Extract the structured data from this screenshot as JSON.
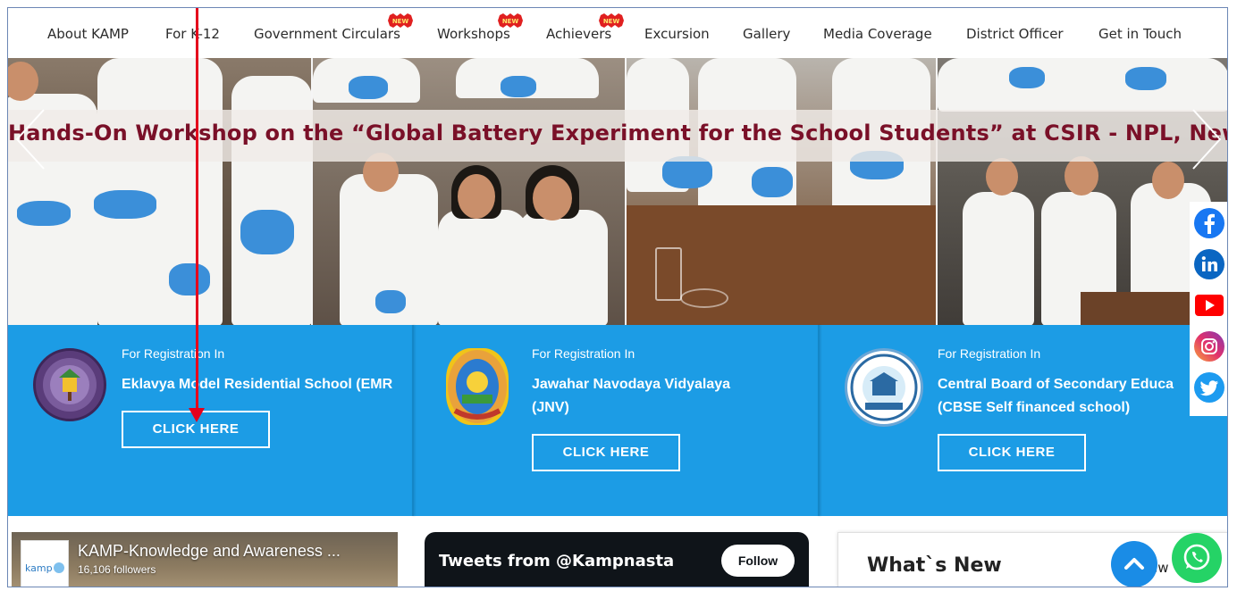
{
  "nav": {
    "items": [
      {
        "label": "About KAMP",
        "new": false
      },
      {
        "label": "For K-12",
        "new": false
      },
      {
        "label": "Government Circulars",
        "new": true
      },
      {
        "label": "Workshops",
        "new": true
      },
      {
        "label": "Achievers",
        "new": true
      },
      {
        "label": "Excursion",
        "new": false
      },
      {
        "label": "Gallery",
        "new": false
      },
      {
        "label": "Media Coverage",
        "new": false
      },
      {
        "label": "District Officer",
        "new": false
      },
      {
        "label": "Get in Touch",
        "new": false
      }
    ],
    "new_badge": "NEW"
  },
  "hero": {
    "banner": "Hands-On Workshop on the “Global Battery Experiment for the School Students” at CSIR - NPL, New Delhi"
  },
  "registration": {
    "prefix": "For Registration In",
    "button": "CLICK HERE",
    "cards": [
      {
        "name_line1": "Eklavya Model Residential School (EMR",
        "name_line2": ""
      },
      {
        "name_line1": "Jawahar Navodaya Vidyalaya",
        "name_line2": "(JNV)"
      },
      {
        "name_line1": "Central Board of Secondary Educa",
        "name_line2": "(CBSE Self financed school)"
      }
    ]
  },
  "social": {
    "icons": [
      "facebook-icon",
      "linkedin-icon",
      "youtube-icon",
      "instagram-icon",
      "twitter-icon"
    ],
    "colors": {
      "facebook": "#1877f2",
      "linkedin": "#0a66c2",
      "youtube": "#ff0000",
      "instagram": "#e1306c",
      "twitter": "#1d9bf0"
    }
  },
  "facebook_widget": {
    "title": "KAMP-Knowledge and Awareness ...",
    "followers": "16,106 followers",
    "logo_text": "kamp"
  },
  "twitter_widget": {
    "title": "Tweets from @Kampnasta",
    "follow": "Follow"
  },
  "whats_new": {
    "title": "What`s New",
    "extra": "ew"
  },
  "colors": {
    "accent": "#1c9ce5",
    "banner_text": "#7a1028",
    "annotation": "#e5001c"
  }
}
